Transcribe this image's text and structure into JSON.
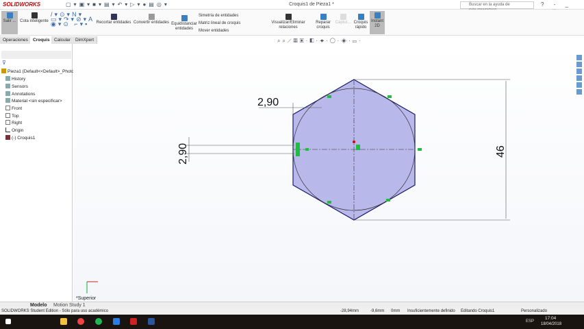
{
  "app": {
    "logo": "SOLIDWORKS",
    "title": "Croquis1 de Pieza1 *",
    "search_placeholder": "Buscar en la ayuda de SOLIDWORKS",
    "window_controls": "? - _ ▫ ×"
  },
  "ribbon": {
    "items": [
      "Salir ...",
      "Cota inteligente",
      "Recortar entidades",
      "Convertir entidades",
      "Equidistanciar entidades",
      "Simetría de entidades",
      "Matriz lineal de croquis",
      "Mover entidades",
      "Visualizar/Eliminar relaciones",
      "Reparar croquis",
      "Captur...",
      "Croquis rápido",
      "Instant 2D"
    ]
  },
  "tabs": [
    "Operaciones",
    "Croquis",
    "Calcular",
    "DimXpert"
  ],
  "tree": {
    "root": "Pieza1  (Default<<Default>_Photo",
    "items": [
      "History",
      "Sensors",
      "Annotations",
      "Material <sin especificar>",
      "Front",
      "Top",
      "Right",
      "Origin",
      "(-) Croquis1"
    ]
  },
  "sketch": {
    "dim_top": "2,90",
    "dim_left": "2,90",
    "dim_height": "46",
    "view_label": "*Superior",
    "line_color": "#1a1a6e",
    "fill_color": "#b8b8ea",
    "relation_color": "#22bb44"
  },
  "bottom_tabs": [
    "Modelo",
    "Motion Study 1"
  ],
  "status": {
    "edition": "SOLIDWORKS Student Edition - Sólo para uso académico",
    "x": "-28,94mm",
    "y": "-9,6mm",
    "z": "0mm",
    "state": "Insuficientemente definido",
    "editing": "Editando Croquis1",
    "units": "Personalizado"
  },
  "taskbar": {
    "lang": "ESP",
    "time": "17:04",
    "date": "18/04/2018"
  }
}
